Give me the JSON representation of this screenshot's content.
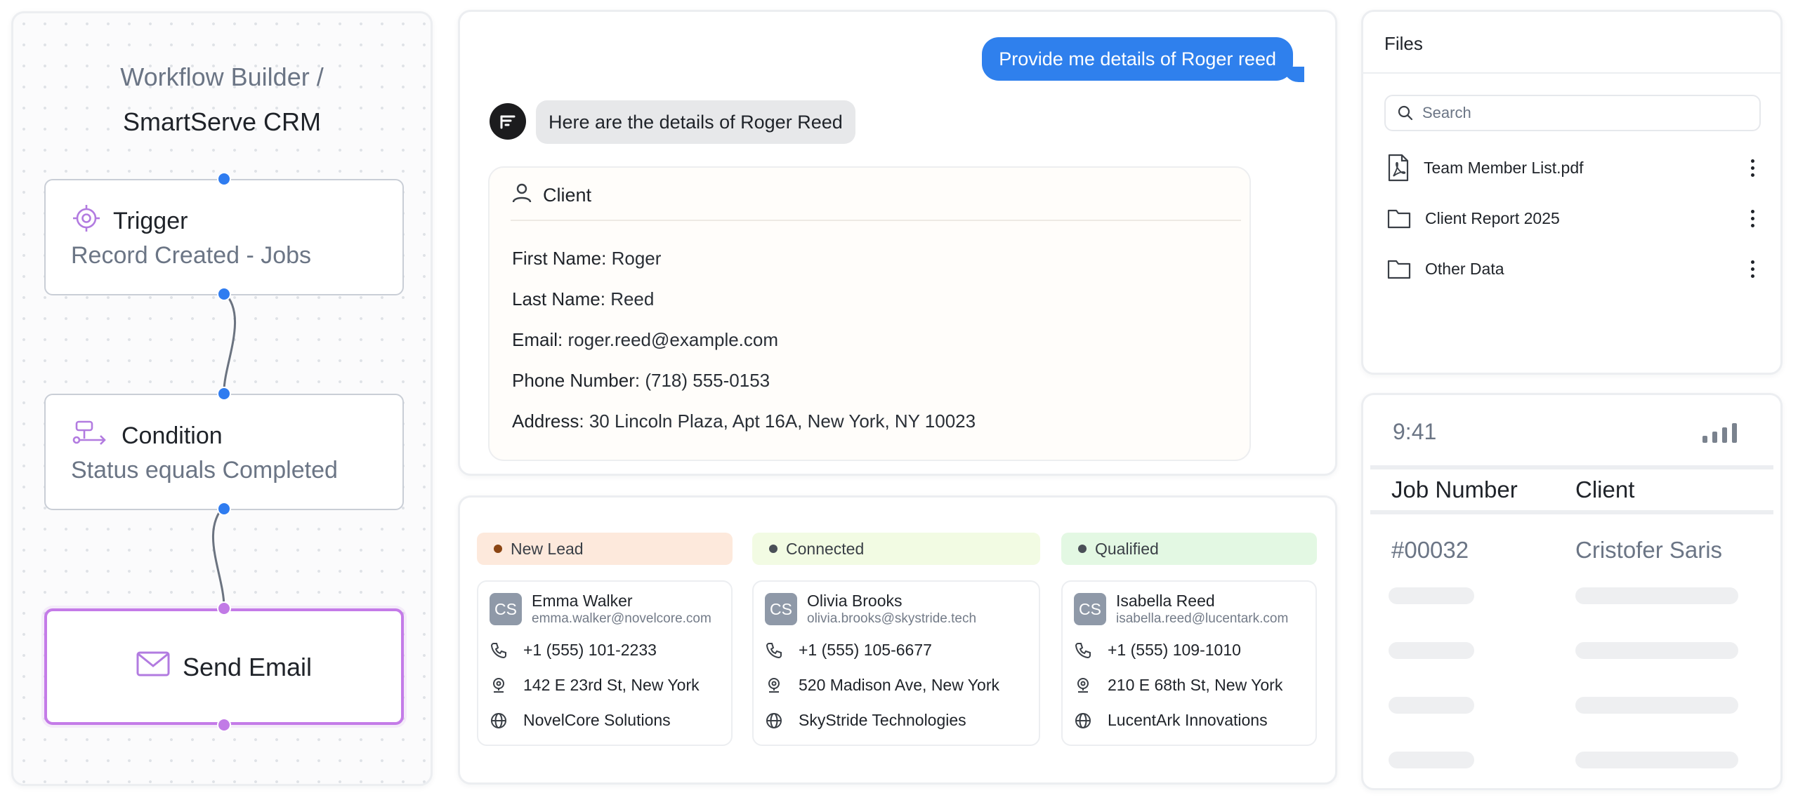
{
  "workflow": {
    "breadcrumb_parent": "Workflow Builder /",
    "title": "SmartServe CRM",
    "nodes": {
      "trigger": {
        "icon": "target-icon",
        "title": "Trigger",
        "subtitle": "Record Created - Jobs"
      },
      "condition": {
        "icon": "branch-icon",
        "title": "Condition",
        "subtitle": "Status equals Completed"
      },
      "email": {
        "icon": "mail-icon",
        "title": "Send Email"
      }
    },
    "colors": {
      "port": "#2f7cf0",
      "email_accent": "#c47be8"
    }
  },
  "chat": {
    "user_message": "Provide me details of Roger reed",
    "bot_message": "Here are the details of Roger Reed",
    "client": {
      "header": "Client",
      "fields": [
        {
          "label": "First Name:",
          "value": "Roger"
        },
        {
          "label": "Last Name:",
          "value": "Reed"
        },
        {
          "label": "Email:",
          "value": "roger.reed@example.com"
        },
        {
          "label": "Phone Number:",
          "value": "(718) 555-0153"
        },
        {
          "label": "Address:",
          "value": "30 Lincoln Plaza, Apt 16A, New York, NY 10023"
        }
      ]
    },
    "colors": {
      "user_bubble": "#2f80ed",
      "bot_bubble": "#e7e8ea"
    }
  },
  "leads": {
    "columns": [
      {
        "stage": "New Lead",
        "stage_bg": "#fde9dc",
        "dot": "#8b4513",
        "card": {
          "initials": "CS",
          "name": "Emma Walker",
          "email": "emma.walker@novelcore.com",
          "phone": "+1 (555) 101-2233",
          "address": "142 E 23rd St, New York",
          "company": "NovelCore Solutions"
        }
      },
      {
        "stage": "Connected",
        "stage_bg": "#f2fbe3",
        "dot": "#4a4f57",
        "card": {
          "initials": "CS",
          "name": "Olivia Brooks",
          "email": "olivia.brooks@skystride.tech",
          "phone": "+1 (555) 105-6677",
          "address": "520 Madison Ave, New York",
          "company": "SkyStride Technologies"
        }
      },
      {
        "stage": "Qualified",
        "stage_bg": "#e3f8e3",
        "dot": "#4a4f57",
        "card": {
          "initials": "CS",
          "name": "Isabella Reed",
          "email": "isabella.reed@lucentark.com",
          "phone": "+1 (555) 109-1010",
          "address": "210 E 68th St, New York",
          "company": "LucentArk Innovations"
        }
      }
    ]
  },
  "files": {
    "title": "Files",
    "search_placeholder": "Search",
    "items": [
      {
        "icon": "pdf-file-icon",
        "name": "Team Member List.pdf"
      },
      {
        "icon": "folder-icon",
        "name": "Client Report 2025"
      },
      {
        "icon": "folder-icon",
        "name": "Other Data"
      }
    ]
  },
  "jobs": {
    "time": "9:41",
    "columns": [
      "Job Number",
      "Client"
    ],
    "rows": [
      {
        "job_number": "#00032",
        "client": "Cristofer Saris"
      }
    ]
  }
}
